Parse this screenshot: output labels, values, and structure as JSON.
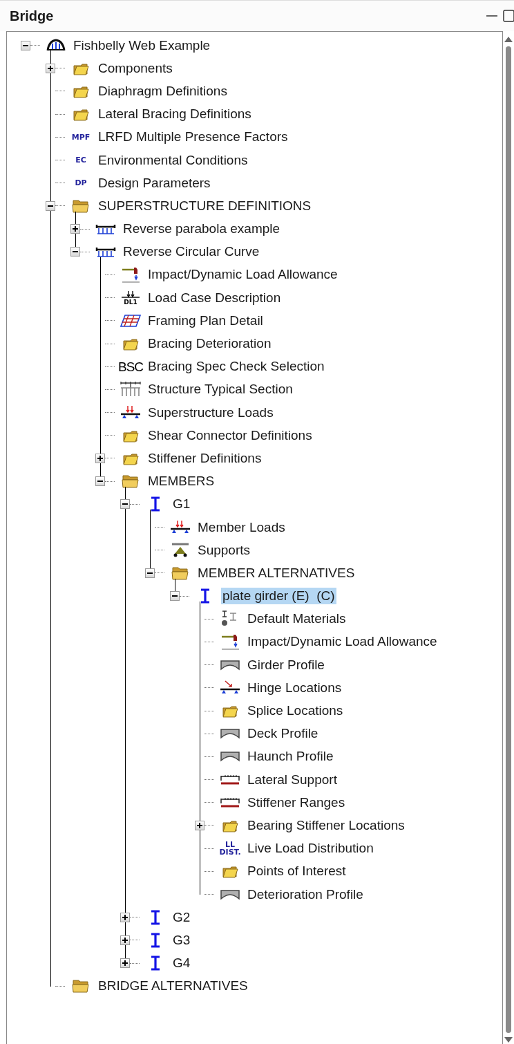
{
  "panel": {
    "title": "Bridge"
  },
  "tree": [
    {
      "label": "Fishbelly Web Example",
      "kind": "bridge",
      "selected": false,
      "expanded": true,
      "children": [
        {
          "label": "Components",
          "kind": "folder",
          "selected": false,
          "expanded": false
        },
        {
          "label": "Diaphragm Definitions",
          "kind": "folder",
          "selected": false
        },
        {
          "label": "Lateral Bracing Definitions",
          "kind": "folder",
          "selected": false
        },
        {
          "label": "LRFD Multiple Presence Factors",
          "kind": "code-small",
          "badge": [
            "MPF"
          ],
          "selected": false
        },
        {
          "label": "Environmental Conditions",
          "kind": "code-small",
          "badge": [
            "EC"
          ],
          "selected": false
        },
        {
          "label": "Design Parameters",
          "kind": "code-small",
          "badge": [
            "DP"
          ],
          "selected": false
        },
        {
          "label": "SUPERSTRUCTURE DEFINITIONS",
          "kind": "folder-open",
          "selected": false,
          "expanded": true,
          "children": [
            {
              "label": "Reverse parabola example",
              "kind": "superstructure",
              "selected": false,
              "expanded": false
            },
            {
              "label": "Reverse Circular Curve",
              "kind": "superstructure",
              "selected": false,
              "expanded": true,
              "children": [
                {
                  "label": "Impact/Dynamic Load Allowance",
                  "kind": "impact",
                  "selected": false
                },
                {
                  "label": "Load Case Description",
                  "kind": "load-case",
                  "badge": [
                    "DL1"
                  ],
                  "selected": false
                },
                {
                  "label": "Framing Plan Detail",
                  "kind": "framing-plan",
                  "selected": false
                },
                {
                  "label": "Bracing Deterioration",
                  "kind": "folder",
                  "selected": false
                },
                {
                  "label": "Bracing Spec Check Selection",
                  "kind": "code-large",
                  "badge": [
                    "BSC"
                  ],
                  "selected": false
                },
                {
                  "label": "Structure Typical Section",
                  "kind": "typical-section",
                  "selected": false
                },
                {
                  "label": "Superstructure Loads",
                  "kind": "loads",
                  "selected": false
                },
                {
                  "label": "Shear Connector Definitions",
                  "kind": "folder",
                  "selected": false
                },
                {
                  "label": "Stiffener Definitions",
                  "kind": "folder",
                  "selected": false,
                  "expanded": false
                },
                {
                  "label": "MEMBERS",
                  "kind": "folder-open",
                  "selected": false,
                  "expanded": true,
                  "children": [
                    {
                      "label": "G1",
                      "kind": "girder",
                      "selected": false,
                      "expanded": true,
                      "children": [
                        {
                          "label": "Member Loads",
                          "kind": "loads",
                          "selected": false
                        },
                        {
                          "label": "Supports",
                          "kind": "supports",
                          "selected": false
                        },
                        {
                          "label": "MEMBER ALTERNATIVES",
                          "kind": "folder-open",
                          "selected": false,
                          "expanded": true,
                          "children": [
                            {
                              "label": "plate girder (E)  (C)",
                              "kind": "girder",
                              "selected": true,
                              "expanded": true,
                              "children": [
                                {
                                  "label": "Default Materials",
                                  "kind": "materials",
                                  "selected": false
                                },
                                {
                                  "label": "Impact/Dynamic Load Allowance",
                                  "kind": "impact",
                                  "selected": false
                                },
                                {
                                  "label": "Girder Profile",
                                  "kind": "profile",
                                  "selected": false
                                },
                                {
                                  "label": "Hinge Locations",
                                  "kind": "hinge",
                                  "selected": false
                                },
                                {
                                  "label": "Splice Locations",
                                  "kind": "folder",
                                  "selected": false
                                },
                                {
                                  "label": "Deck Profile",
                                  "kind": "profile",
                                  "selected": false
                                },
                                {
                                  "label": "Haunch Profile",
                                  "kind": "profile",
                                  "selected": false
                                },
                                {
                                  "label": "Lateral Support",
                                  "kind": "range",
                                  "selected": false
                                },
                                {
                                  "label": "Stiffener Ranges",
                                  "kind": "range",
                                  "selected": false
                                },
                                {
                                  "label": "Bearing Stiffener Locations",
                                  "kind": "folder",
                                  "selected": false,
                                  "expanded": false
                                },
                                {
                                  "label": "Live Load Distribution",
                                  "kind": "code-small",
                                  "badge": [
                                    "LL",
                                    "DIST."
                                  ],
                                  "selected": false
                                },
                                {
                                  "label": "Points of Interest",
                                  "kind": "folder",
                                  "selected": false
                                },
                                {
                                  "label": "Deterioration Profile",
                                  "kind": "profile",
                                  "selected": false
                                }
                              ]
                            }
                          ]
                        }
                      ]
                    },
                    {
                      "label": "G2",
                      "kind": "girder",
                      "selected": false,
                      "expanded": false
                    },
                    {
                      "label": "G3",
                      "kind": "girder",
                      "selected": false,
                      "expanded": false
                    },
                    {
                      "label": "G4",
                      "kind": "girder",
                      "selected": false,
                      "expanded": false
                    }
                  ]
                }
              ]
            }
          ]
        },
        {
          "label": "BRIDGE ALTERNATIVES",
          "kind": "folder-open",
          "selected": false
        }
      ]
    }
  ]
}
